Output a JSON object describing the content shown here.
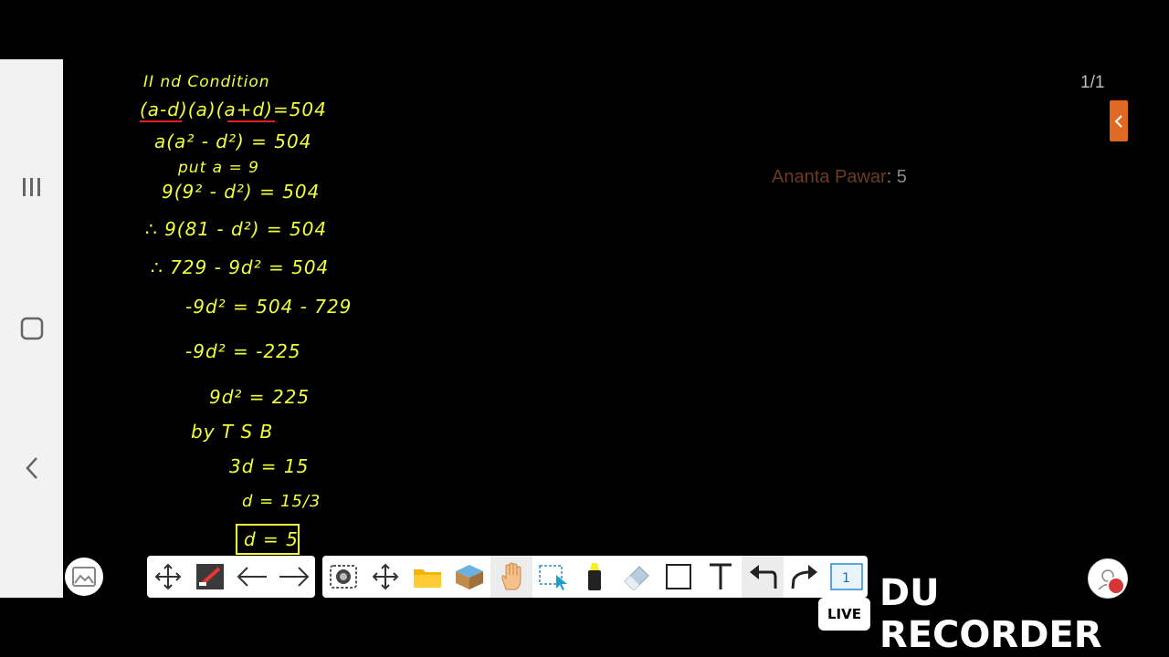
{
  "nav": {
    "buttons": [
      {
        "name": "recent-apps",
        "icon": "recent-apps-icon"
      },
      {
        "name": "home",
        "icon": "home-icon"
      },
      {
        "name": "back",
        "icon": "back-icon"
      }
    ]
  },
  "board": {
    "page_counter": "1/1",
    "participant_name": "Ananta Pawar",
    "participant_score": ": 5",
    "lines": [
      "II nd Condition",
      "(a-d)(a)(a+d)=504",
      "a(a² - d²) = 504",
      "put a = 9",
      "9(9² - d²) = 504",
      "∴ 9(81 - d²) = 504",
      "∴ 729 - 9d² = 504",
      "-9d² = 504 - 729",
      "-9d² = -225",
      "9d² = 225",
      "by T S B",
      "3d = 15",
      "d = 15/3",
      "d = 5"
    ],
    "ink_color": "#f2ff3a",
    "underline_color": "#e02020"
  },
  "toolbar": {
    "left_tools": [
      "move-icon",
      "color-pen-icon",
      "undo-arrow-icon",
      "redo-arrow-icon"
    ],
    "right_tools": [
      "screenshot-icon",
      "move-icon",
      "folder-icon",
      "3d-box-icon",
      "hand-icon",
      "select-icon",
      "highlighter-icon",
      "eraser-icon",
      "rectangle-icon",
      "text-icon",
      "undo-icon",
      "redo-icon",
      "page-icon"
    ],
    "page_number": "1"
  },
  "watermark": {
    "live_badge": "LIVE",
    "text": "DU RECORDER"
  }
}
